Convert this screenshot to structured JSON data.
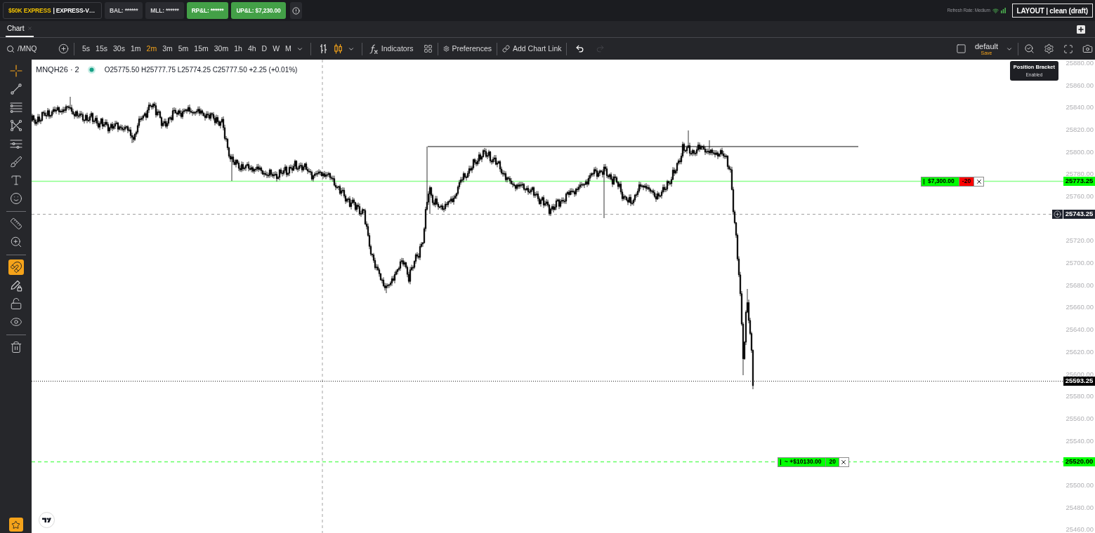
{
  "top_bar": {
    "account": {
      "name": "$50K EXPRESS",
      "detail": "| EXPRESS-V…"
    },
    "stats": [
      {
        "label": "BAL: ******",
        "kind": "neutral"
      },
      {
        "label": "MLL: ******",
        "kind": "neutral"
      },
      {
        "label": "RP&L: ******",
        "kind": "profit"
      },
      {
        "label": "UP&L: $7,230.00",
        "kind": "profit"
      }
    ],
    "refresh_rate": "Refresh Rate: Medium",
    "layout_button": "LAYOUT | clean (draft)"
  },
  "tabs": [
    {
      "label": "Chart",
      "selected": true
    }
  ],
  "toolbar": {
    "symbol": "/MNQ",
    "intervals": [
      {
        "label": "5s",
        "selected": false
      },
      {
        "label": "15s",
        "selected": false
      },
      {
        "label": "30s",
        "selected": false
      },
      {
        "label": "1m",
        "selected": false
      },
      {
        "label": "2m",
        "selected": true
      },
      {
        "label": "3m",
        "selected": false
      },
      {
        "label": "5m",
        "selected": false
      },
      {
        "label": "15m",
        "selected": false
      },
      {
        "label": "30m",
        "selected": false
      },
      {
        "label": "1h",
        "selected": false
      },
      {
        "label": "4h",
        "selected": false
      },
      {
        "label": "D",
        "selected": false
      },
      {
        "label": "W",
        "selected": false
      },
      {
        "label": "M",
        "selected": false
      }
    ],
    "chart_types": [
      {
        "kind": "bars",
        "selected": false
      },
      {
        "kind": "candles",
        "selected": true
      }
    ],
    "indicators": "Indicators",
    "preferences": "Preferences",
    "chart_link": "Add Chart Link",
    "history": [
      {
        "kind": "undo",
        "disabled": false
      },
      {
        "kind": "redo",
        "disabled": true
      }
    ],
    "layout": {
      "name": "default",
      "action": "Save"
    }
  },
  "left_toolbar": {
    "groups": [
      {
        "tools": [
          {
            "kind": "crosshair",
            "selected": true
          },
          {
            "kind": "trendline",
            "selected": false
          },
          {
            "kind": "fibonacci",
            "selected": false
          },
          {
            "kind": "pattern",
            "selected": false
          },
          {
            "kind": "forecast",
            "selected": false
          },
          {
            "kind": "brush",
            "selected": false
          },
          {
            "kind": "text",
            "selected": false
          },
          {
            "kind": "emoji",
            "selected": false
          }
        ]
      },
      {
        "tools": [
          {
            "kind": "ruler",
            "selected": false
          },
          {
            "kind": "zoom",
            "selected": false
          }
        ]
      },
      {
        "tools": [
          {
            "kind": "magnet",
            "on": true
          },
          {
            "kind": "drawlock",
            "on": false
          },
          {
            "kind": "lock",
            "on": false
          },
          {
            "kind": "hide",
            "on": false
          }
        ]
      },
      {
        "tools": [
          {
            "kind": "trash"
          }
        ]
      }
    ],
    "favorites": {
      "on": true
    }
  },
  "chart": {
    "symbol": "MNQH26 · 2",
    "ohlc": "O25775.50 H25777.75 L25774.25 C25777.50 +2.25 (+0.01%)",
    "tooltip": {
      "title": "Position Bracket",
      "status": "Enabled"
    },
    "price_lines": [
      {
        "kind": "position",
        "tag": "25773.25",
        "color": "#00ff00",
        "order": {
          "pnl": "$7,300.00",
          "qty": "-20",
          "color": "#ff0000"
        }
      },
      {
        "kind": "crosshair",
        "tag": "25743.25"
      },
      {
        "kind": "last",
        "tag": "25593.25"
      },
      {
        "kind": "target",
        "tag": "25520.00",
        "color": "#00ff00",
        "order": {
          "pnl": "~ +$10130.00",
          "qty": "20",
          "color": "#00ff00"
        }
      }
    ],
    "price_axis": [
      "25880.00",
      "25860.00",
      "25840.00",
      "25820.00",
      "25800.00",
      "25780.00",
      "25760.00",
      "25720.00",
      "25700.00",
      "25680.00",
      "25660.00",
      "25640.00",
      "25620.00",
      "25600.00",
      "25580.00",
      "25560.00",
      "25540.00",
      "25500.00",
      "25480.00",
      "25460.00"
    ]
  }
}
